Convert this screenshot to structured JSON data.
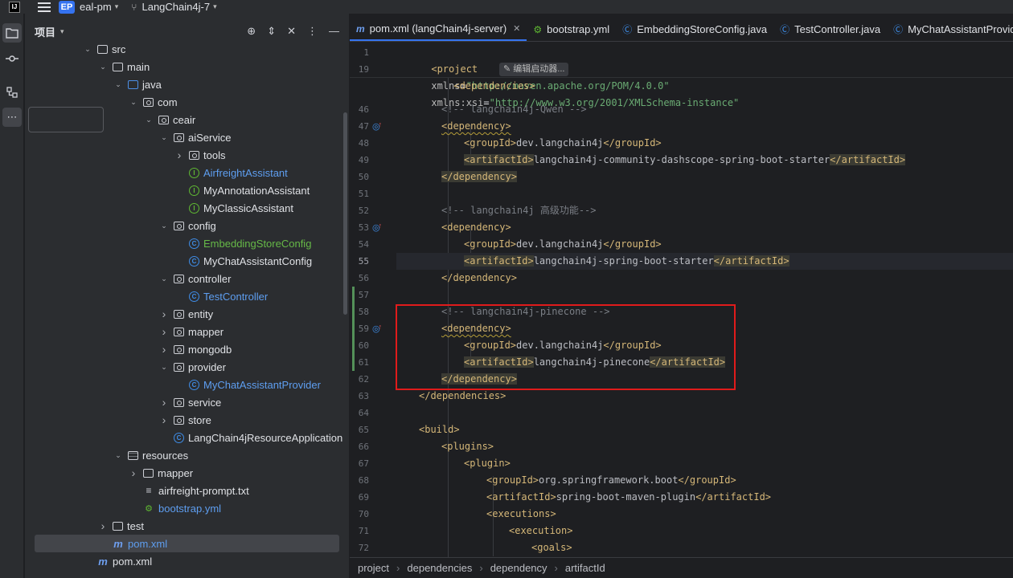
{
  "titlebar": {
    "project_badge": "EP",
    "project_name": "eal-pm",
    "branch": "LangChain4j-7"
  },
  "project_panel": {
    "title": "项目",
    "tree": [
      {
        "label": "src",
        "icon": "folder-icon",
        "depth": 4,
        "arrow": "down"
      },
      {
        "label": "main",
        "icon": "folder-icon",
        "depth": 5,
        "arrow": "down"
      },
      {
        "label": "java",
        "icon": "source-folder-icon",
        "depth": 6,
        "arrow": "down"
      },
      {
        "label": "com",
        "icon": "package-icon",
        "depth": 7,
        "arrow": "down"
      },
      {
        "label": "ceair",
        "icon": "package-icon",
        "depth": 8,
        "arrow": "down"
      },
      {
        "label": "aiService",
        "icon": "package-icon",
        "depth": 9,
        "arrow": "down"
      },
      {
        "label": "tools",
        "icon": "package-icon",
        "depth": 10,
        "arrow": "right"
      },
      {
        "label": "AirfreightAssistant",
        "icon": "interface-icon",
        "depth": 10,
        "arrow": "",
        "color": "blue"
      },
      {
        "label": "MyAnnotationAssistant",
        "icon": "interface-icon",
        "depth": 10,
        "arrow": ""
      },
      {
        "label": "MyClassicAssistant",
        "icon": "interface-icon",
        "depth": 10,
        "arrow": ""
      },
      {
        "label": "config",
        "icon": "package-icon",
        "depth": 9,
        "arrow": "down"
      },
      {
        "label": "EmbeddingStoreConfig",
        "icon": "class-icon",
        "depth": 10,
        "arrow": "",
        "color": "green"
      },
      {
        "label": "MyChatAssistantConfig",
        "icon": "class-icon",
        "depth": 10,
        "arrow": ""
      },
      {
        "label": "controller",
        "icon": "package-icon",
        "depth": 9,
        "arrow": "down"
      },
      {
        "label": "TestController",
        "icon": "class-icon",
        "depth": 10,
        "arrow": "",
        "color": "blue"
      },
      {
        "label": "entity",
        "icon": "package-icon",
        "depth": 9,
        "arrow": "right"
      },
      {
        "label": "mapper",
        "icon": "package-icon",
        "depth": 9,
        "arrow": "right"
      },
      {
        "label": "mongodb",
        "icon": "package-icon",
        "depth": 9,
        "arrow": "right"
      },
      {
        "label": "provider",
        "icon": "package-icon",
        "depth": 9,
        "arrow": "down"
      },
      {
        "label": "MyChatAssistantProvider",
        "icon": "class-icon",
        "depth": 10,
        "arrow": "",
        "color": "blue"
      },
      {
        "label": "service",
        "icon": "package-icon",
        "depth": 9,
        "arrow": "right"
      },
      {
        "label": "store",
        "icon": "package-icon",
        "depth": 9,
        "arrow": "right"
      },
      {
        "label": "LangChain4jResourceApplication",
        "icon": "spring-app-icon",
        "depth": 9,
        "arrow": ""
      },
      {
        "label": "resources",
        "icon": "resources-folder-icon",
        "depth": 6,
        "arrow": "down"
      },
      {
        "label": "mapper",
        "icon": "folder-icon",
        "depth": 7,
        "arrow": "right"
      },
      {
        "label": "airfreight-prompt.txt",
        "icon": "text-file-icon",
        "depth": 7,
        "arrow": ""
      },
      {
        "label": "bootstrap.yml",
        "icon": "yaml-file-icon",
        "depth": 7,
        "arrow": "",
        "color": "blue"
      },
      {
        "label": "test",
        "icon": "folder-icon",
        "depth": 5,
        "arrow": "right"
      },
      {
        "label": "pom.xml",
        "icon": "maven-icon",
        "depth": 5,
        "arrow": "",
        "color": "blue",
        "selected": true
      },
      {
        "label": "pom.xml",
        "icon": "maven-icon",
        "depth": 4,
        "arrow": ""
      }
    ]
  },
  "editor": {
    "tabs": [
      {
        "label": "pom.xml (langChain4j-server)",
        "icon": "maven-icon",
        "active": true
      },
      {
        "label": "bootstrap.yml",
        "icon": "yaml-file-icon"
      },
      {
        "label": "EmbeddingStoreConfig.java",
        "icon": "class-icon"
      },
      {
        "label": "TestController.java",
        "icon": "class-icon"
      },
      {
        "label": "MyChatAssistantProvider.java",
        "icon": "class-icon"
      }
    ],
    "sticky": {
      "line1_num": "1",
      "line1_tag": "<project",
      "line1_a1": "xmlns",
      "line1_v1": "\"http://maven.apache.org/POM/4.0.0\"",
      "line1_a2": "xmlns:xsi",
      "line1_v2": "\"http://www.w3.org/2001/XMLSchema-instance\"",
      "line2_num": "19",
      "line2_tag": "<dependencies>",
      "hint": "编辑启动器..."
    },
    "lines": [
      {
        "n": "46",
        "indent": 2,
        "parts": [
          {
            "c": "cmt",
            "t": "<!-- langchain4j-Qwen -->"
          }
        ]
      },
      {
        "n": "47",
        "indent": 2,
        "mark": true,
        "parts": [
          {
            "c": "tag wavy",
            "t": "<dependency>"
          }
        ]
      },
      {
        "n": "48",
        "indent": 3,
        "parts": [
          {
            "c": "tag",
            "t": "<groupId>"
          },
          {
            "c": "txt",
            "t": "dev.langchain4j"
          },
          {
            "c": "tag",
            "t": "</groupId>"
          }
        ]
      },
      {
        "n": "49",
        "indent": 3,
        "parts": [
          {
            "c": "tag hlbox",
            "t": "<artifactId>"
          },
          {
            "c": "txt",
            "t": "langchain4j-community-dashscope-spring-boot-starter"
          },
          {
            "c": "tag hlbox",
            "t": "</artifactId>"
          }
        ]
      },
      {
        "n": "50",
        "indent": 2,
        "parts": [
          {
            "c": "tag hlbox",
            "t": "</dependency>"
          }
        ]
      },
      {
        "n": "51",
        "indent": 0,
        "parts": []
      },
      {
        "n": "52",
        "indent": 2,
        "parts": [
          {
            "c": "cmt",
            "t": "<!-- langchain4j 高级功能-->"
          }
        ]
      },
      {
        "n": "53",
        "indent": 2,
        "mark": true,
        "parts": [
          {
            "c": "tag",
            "t": "<dependency>"
          }
        ]
      },
      {
        "n": "54",
        "indent": 3,
        "parts": [
          {
            "c": "tag",
            "t": "<groupId>"
          },
          {
            "c": "txt",
            "t": "dev.langchain4j"
          },
          {
            "c": "tag",
            "t": "</groupId>"
          }
        ]
      },
      {
        "n": "55",
        "indent": 3,
        "current": true,
        "parts": [
          {
            "c": "tag hlbox",
            "t": "<artifactId>"
          },
          {
            "c": "txt",
            "t": "langchain4j-spring-boot-starter"
          },
          {
            "c": "tag hlbox",
            "t": "</artifactId>"
          }
        ]
      },
      {
        "n": "56",
        "indent": 2,
        "parts": [
          {
            "c": "tag",
            "t": "</dependency>"
          }
        ]
      },
      {
        "n": "57",
        "indent": 0,
        "parts": []
      },
      {
        "n": "58",
        "indent": 2,
        "parts": [
          {
            "c": "cmt",
            "t": "<!-- langchain4j-pinecone -->"
          }
        ]
      },
      {
        "n": "59",
        "indent": 2,
        "mark": true,
        "parts": [
          {
            "c": "tag wavy",
            "t": "<dependency>"
          }
        ]
      },
      {
        "n": "60",
        "indent": 3,
        "parts": [
          {
            "c": "tag",
            "t": "<groupId>"
          },
          {
            "c": "txt",
            "t": "dev.langchain4j"
          },
          {
            "c": "tag",
            "t": "</groupId>"
          }
        ]
      },
      {
        "n": "61",
        "indent": 3,
        "parts": [
          {
            "c": "tag hlbox",
            "t": "<artifactId>"
          },
          {
            "c": "txt",
            "t": "langchain4j-pinecone"
          },
          {
            "c": "tag hlbox",
            "t": "</artifactId>"
          }
        ]
      },
      {
        "n": "62",
        "indent": 2,
        "parts": [
          {
            "c": "tag hlbox",
            "t": "</dependency>"
          }
        ]
      },
      {
        "n": "63",
        "indent": 1,
        "parts": [
          {
            "c": "tag",
            "t": "</dependencies>"
          }
        ]
      },
      {
        "n": "64",
        "indent": 0,
        "parts": []
      },
      {
        "n": "65",
        "indent": 1,
        "parts": [
          {
            "c": "tag",
            "t": "<build>"
          }
        ]
      },
      {
        "n": "66",
        "indent": 2,
        "parts": [
          {
            "c": "tag",
            "t": "<plugins>"
          }
        ]
      },
      {
        "n": "67",
        "indent": 3,
        "parts": [
          {
            "c": "tag",
            "t": "<plugin>"
          }
        ]
      },
      {
        "n": "68",
        "indent": 4,
        "parts": [
          {
            "c": "tag",
            "t": "<groupId>"
          },
          {
            "c": "txt",
            "t": "org.springframework.boot"
          },
          {
            "c": "tag",
            "t": "</groupId>"
          }
        ]
      },
      {
        "n": "69",
        "indent": 4,
        "parts": [
          {
            "c": "tag",
            "t": "<artifactId>"
          },
          {
            "c": "txt",
            "t": "spring-boot-maven-plugin"
          },
          {
            "c": "tag",
            "t": "</artifactId>"
          }
        ]
      },
      {
        "n": "70",
        "indent": 4,
        "parts": [
          {
            "c": "tag",
            "t": "<executions>"
          }
        ]
      },
      {
        "n": "71",
        "indent": 5,
        "parts": [
          {
            "c": "tag",
            "t": "<execution>"
          }
        ]
      },
      {
        "n": "72",
        "indent": 6,
        "parts": [
          {
            "c": "tag",
            "t": "<goals>"
          }
        ]
      }
    ],
    "breadcrumb": [
      "project",
      "dependencies",
      "dependency",
      "artifactId"
    ]
  }
}
